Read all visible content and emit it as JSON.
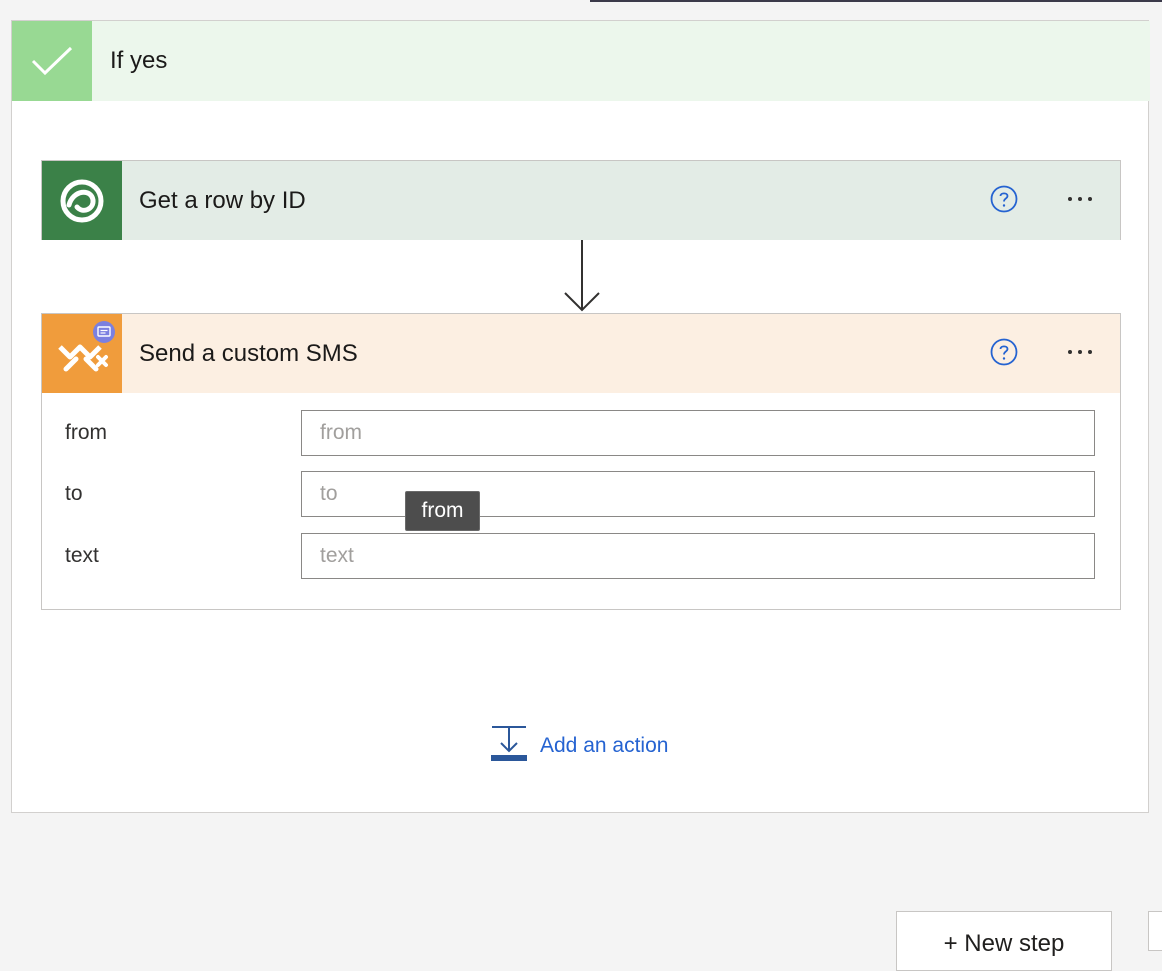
{
  "branch": {
    "title": "If yes"
  },
  "steps": [
    {
      "title": "Get a row by ID",
      "icon": "dataverse-icon",
      "accent": "#3b8148"
    },
    {
      "title": "Send a custom SMS",
      "icon": "sms-connector-icon",
      "accent": "#f09c3c",
      "fields": [
        {
          "label": "from",
          "placeholder": "from"
        },
        {
          "label": "to",
          "placeholder": "to"
        },
        {
          "label": "text",
          "placeholder": "text"
        }
      ]
    }
  ],
  "tooltip": {
    "text": "from"
  },
  "add_action": {
    "label": "Add an action"
  },
  "footer": {
    "new_step_label": "+ New step"
  }
}
